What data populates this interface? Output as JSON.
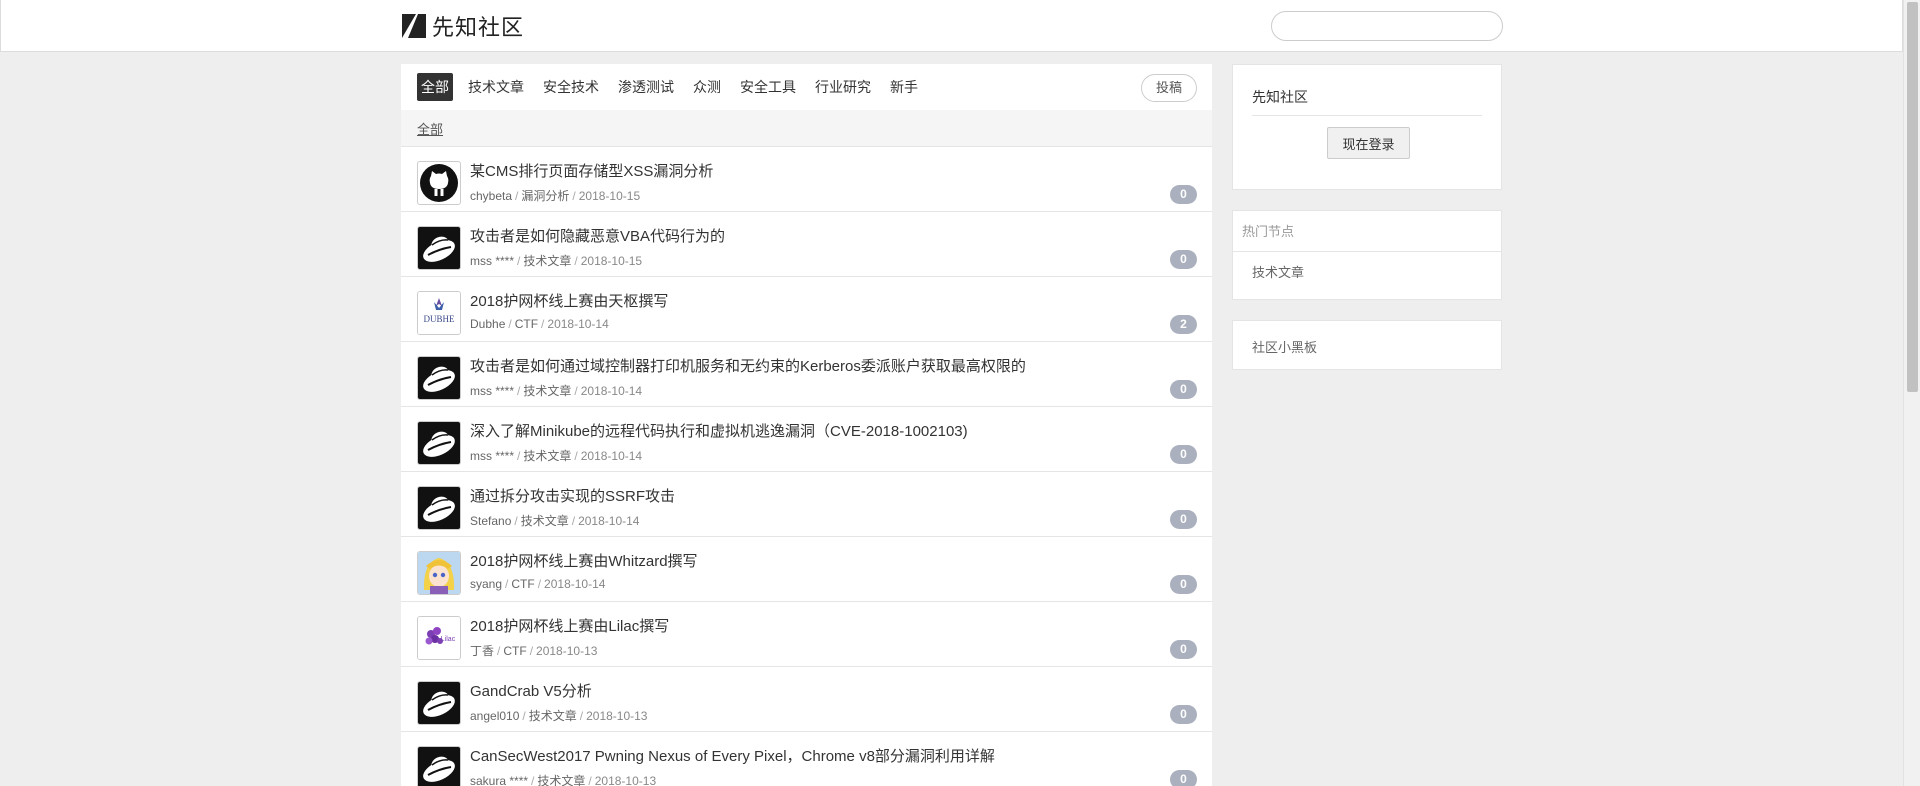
{
  "header": {
    "logo_text": "先知社区",
    "search_placeholder": ""
  },
  "tabs": [
    {
      "label": "全部",
      "active": true
    },
    {
      "label": "技术文章",
      "active": false
    },
    {
      "label": "安全技术",
      "active": false
    },
    {
      "label": "渗透测试",
      "active": false
    },
    {
      "label": "众测",
      "active": false
    },
    {
      "label": "安全工具",
      "active": false
    },
    {
      "label": "行业研究",
      "active": false
    },
    {
      "label": "新手",
      "active": false
    }
  ],
  "post_button": "投稿",
  "breadcrumb": "全部",
  "topics": [
    {
      "title": "某CMS排行页面存储型XSS漏洞分析",
      "author": "chybeta",
      "node": "漏洞分析",
      "date": "2018-10-15",
      "replies": "0",
      "avatar": "github-cat-icon"
    },
    {
      "title": "攻击者是如何隐藏恶意VBA代码行为的",
      "author": "mss ****",
      "node": "技术文章",
      "date": "2018-10-15",
      "replies": "0",
      "avatar": "hat-icon"
    },
    {
      "title": "2018护网杯线上赛由天枢撰写",
      "author": "Dubhe",
      "node": "CTF",
      "date": "2018-10-14",
      "replies": "2",
      "avatar": "dubhe-logo-icon"
    },
    {
      "title": "攻击者是如何通过域控制器打印机服务和无约束的Kerberos委派账户获取最高权限的",
      "author": "mss ****",
      "node": "技术文章",
      "date": "2018-10-14",
      "replies": "0",
      "avatar": "hat-icon"
    },
    {
      "title": "深入了解Minikube的远程代码执行和虚拟机逃逸漏洞（CVE-2018-1002103)",
      "author": "mss ****",
      "node": "技术文章",
      "date": "2018-10-14",
      "replies": "0",
      "avatar": "hat-icon"
    },
    {
      "title": "通过拆分攻击实现的SSRF攻击",
      "author": "Stefano",
      "node": "技术文章",
      "date": "2018-10-14",
      "replies": "0",
      "avatar": "hat-icon"
    },
    {
      "title": "2018护网杯线上赛由Whitzard撰写",
      "author": "syang",
      "node": "CTF",
      "date": "2018-10-14",
      "replies": "0",
      "avatar": "anime-girl-icon"
    },
    {
      "title": "2018护网杯线上赛由Lilac撰写",
      "author": "丁香",
      "node": "CTF",
      "date": "2018-10-13",
      "replies": "0",
      "avatar": "lilac-logo-icon"
    },
    {
      "title": "GandCrab V5分析",
      "author": "angel010",
      "node": "技术文章",
      "date": "2018-10-13",
      "replies": "0",
      "avatar": "hat-icon"
    },
    {
      "title": "CanSecWest2017 Pwning Nexus of Every Pixel，Chrome v8部分漏洞利用详解",
      "author": "sakura ****",
      "node": "技术文章",
      "date": "2018-10-13",
      "replies": "0",
      "avatar": "hat-icon"
    }
  ],
  "sidebar": {
    "community_title": "先知社区",
    "login_button": "现在登录",
    "hot_nodes_title": "热门节点",
    "hot_nodes": [
      "技术文章"
    ],
    "blackboard_link": "社区小黑板"
  }
}
